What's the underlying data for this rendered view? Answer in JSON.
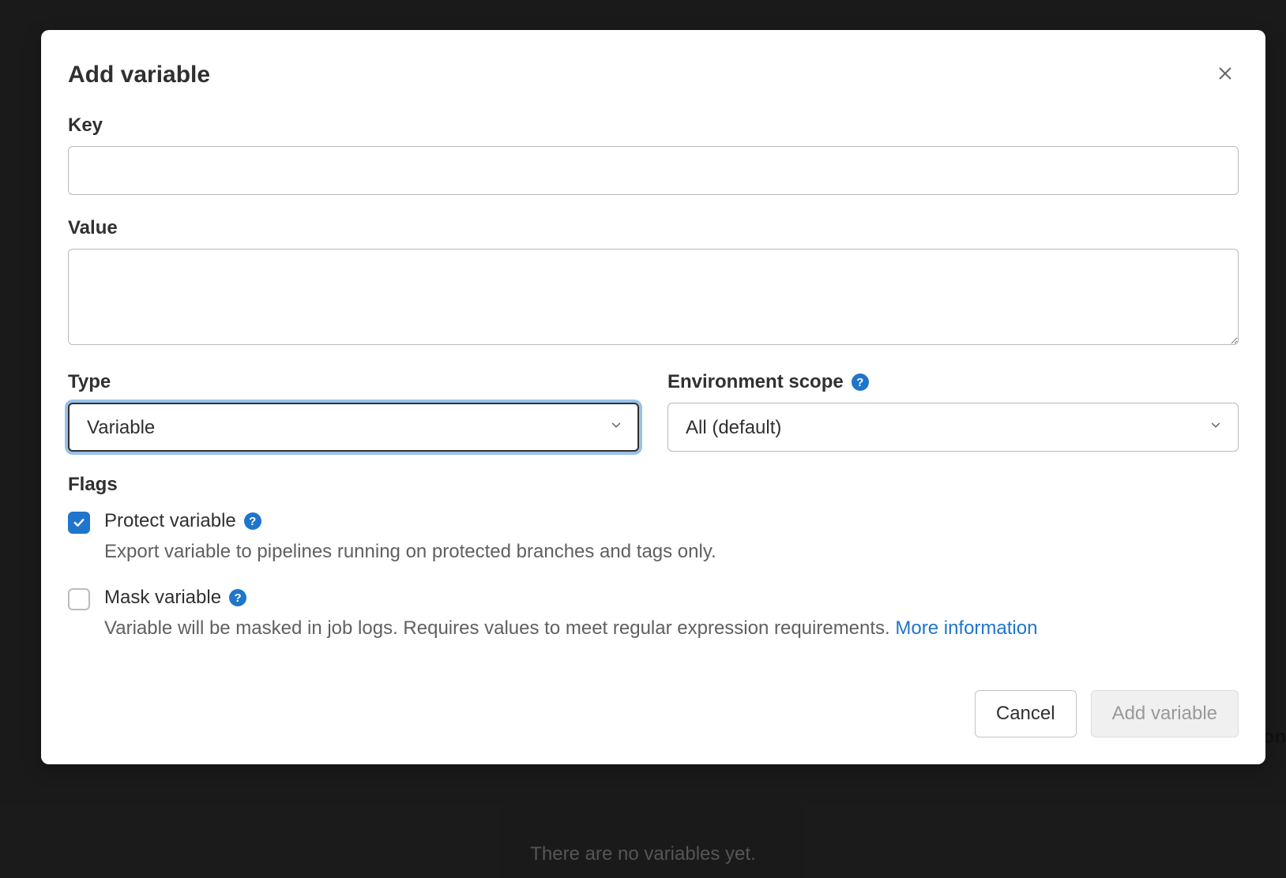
{
  "modal": {
    "title": "Add variable",
    "key": {
      "label": "Key",
      "value": ""
    },
    "value": {
      "label": "Value",
      "value": ""
    },
    "type": {
      "label": "Type",
      "selected": "Variable"
    },
    "env_scope": {
      "label": "Environment scope",
      "selected": "All (default)"
    },
    "flags": {
      "label": "Flags",
      "protect": {
        "label": "Protect variable",
        "checked": true,
        "desc": "Export variable to pipelines running on protected branches and tags only."
      },
      "mask": {
        "label": "Mask variable",
        "checked": false,
        "desc": "Variable will be masked in job logs. Requires values to meet regular expression requirements. ",
        "link_text": "More information"
      }
    },
    "footer": {
      "cancel": "Cancel",
      "submit": "Add variable"
    }
  },
  "background": {
    "no_variables": "There are no variables yet.",
    "right_fragment": "ron"
  }
}
